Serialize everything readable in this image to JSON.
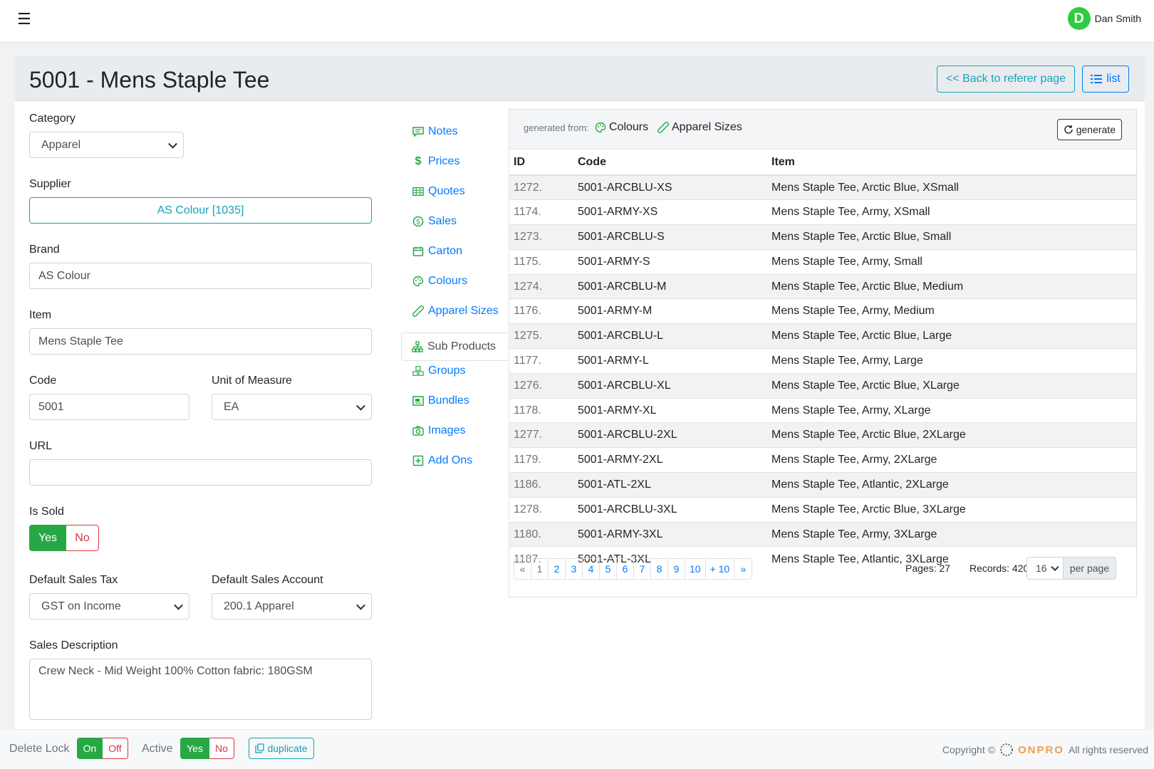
{
  "topbar": {
    "user_initial": "D",
    "user_name": "Dan Smith"
  },
  "header": {
    "title": "5001 - Mens Staple Tee",
    "back_label": "<< Back to referer page",
    "list_label": "list"
  },
  "form": {
    "category": {
      "label": "Category",
      "value": "Apparel"
    },
    "supplier": {
      "label": "Supplier",
      "value": "AS Colour [1035]"
    },
    "brand": {
      "label": "Brand",
      "value": "AS Colour"
    },
    "item": {
      "label": "Item",
      "value": "Mens Staple Tee"
    },
    "code": {
      "label": "Code",
      "value": "5001"
    },
    "uom": {
      "label": "Unit of Measure",
      "value": "EA"
    },
    "url": {
      "label": "URL",
      "value": ""
    },
    "is_sold": {
      "label": "Is Sold",
      "yes": "Yes",
      "no": "No"
    },
    "sales_tax": {
      "label": "Default Sales Tax",
      "value": "GST on Income"
    },
    "sales_account": {
      "label": "Default Sales Account",
      "value": "200.1 Apparel"
    },
    "sales_description": {
      "label": "Sales Description",
      "value": "Crew Neck - Mid Weight 100% Cotton fabric: 180GSM"
    }
  },
  "sidenav": [
    {
      "label": "Notes",
      "icon": "comment-icon"
    },
    {
      "label": "Prices",
      "icon": "dollar-icon"
    },
    {
      "label": "Quotes",
      "icon": "table-icon"
    },
    {
      "label": "Sales",
      "icon": "coin-icon"
    },
    {
      "label": "Carton",
      "icon": "calendar-icon"
    },
    {
      "label": "Colours",
      "icon": "palette-icon"
    },
    {
      "label": "Apparel Sizes",
      "icon": "ruler-icon"
    },
    {
      "label": "Sub Products",
      "icon": "hierarchy-icon"
    },
    {
      "label": "Groups",
      "icon": "boxes-icon"
    },
    {
      "label": "Bundles",
      "icon": "bundle-icon"
    },
    {
      "label": "Images",
      "icon": "camera-icon"
    },
    {
      "label": "Add Ons",
      "icon": "plus-square-icon"
    }
  ],
  "panel": {
    "generated_from": "generated from:",
    "source_1": "Colours",
    "source_2": "Apparel Sizes",
    "generate_label": "generate",
    "columns": [
      "ID",
      "Code",
      "Item"
    ],
    "rows": [
      [
        "1272.",
        "5001-ARCBLU-XS",
        "Mens Staple Tee, Arctic Blue, XSmall"
      ],
      [
        "1174.",
        "5001-ARMY-XS",
        "Mens Staple Tee, Army, XSmall"
      ],
      [
        "1273.",
        "5001-ARCBLU-S",
        "Mens Staple Tee, Arctic Blue, Small"
      ],
      [
        "1175.",
        "5001-ARMY-S",
        "Mens Staple Tee, Army, Small"
      ],
      [
        "1274.",
        "5001-ARCBLU-M",
        "Mens Staple Tee, Arctic Blue, Medium"
      ],
      [
        "1176.",
        "5001-ARMY-M",
        "Mens Staple Tee, Army, Medium"
      ],
      [
        "1275.",
        "5001-ARCBLU-L",
        "Mens Staple Tee, Arctic Blue, Large"
      ],
      [
        "1177.",
        "5001-ARMY-L",
        "Mens Staple Tee, Army, Large"
      ],
      [
        "1276.",
        "5001-ARCBLU-XL",
        "Mens Staple Tee, Arctic Blue, XLarge"
      ],
      [
        "1178.",
        "5001-ARMY-XL",
        "Mens Staple Tee, Army, XLarge"
      ],
      [
        "1277.",
        "5001-ARCBLU-2XL",
        "Mens Staple Tee, Arctic Blue, 2XLarge"
      ],
      [
        "1179.",
        "5001-ARMY-2XL",
        "Mens Staple Tee, Army, 2XLarge"
      ],
      [
        "1186.",
        "5001-ATL-2XL",
        "Mens Staple Tee, Atlantic, 2XLarge"
      ],
      [
        "1278.",
        "5001-ARCBLU-3XL",
        "Mens Staple Tee, Arctic Blue, 3XLarge"
      ],
      [
        "1180.",
        "5001-ARMY-3XL",
        "Mens Staple Tee, Army, 3XLarge"
      ],
      [
        "1187.",
        "5001-ATL-3XL",
        "Mens Staple Tee, Atlantic, 3XLarge"
      ]
    ],
    "pager": [
      "«",
      "1",
      "2",
      "3",
      "4",
      "5",
      "6",
      "7",
      "8",
      "9",
      "10",
      "+ 10",
      "»"
    ],
    "pages_text": "Pages: 27",
    "records_text": "Records: 420",
    "per_page_value": "16",
    "per_page_label": "per page"
  },
  "footer": {
    "delete_lock": "Delete Lock",
    "on": "On",
    "off": "Off",
    "active": "Active",
    "yes": "Yes",
    "no": "No",
    "duplicate": "duplicate",
    "copyright": "Copyright ©",
    "brand": "ONPRO",
    "rights": "All rights reserved"
  },
  "colors": {
    "primary": "#007bff",
    "info": "#17a2b8",
    "success": "#28a745",
    "danger": "#dc3545",
    "brand": "#f0a050"
  }
}
